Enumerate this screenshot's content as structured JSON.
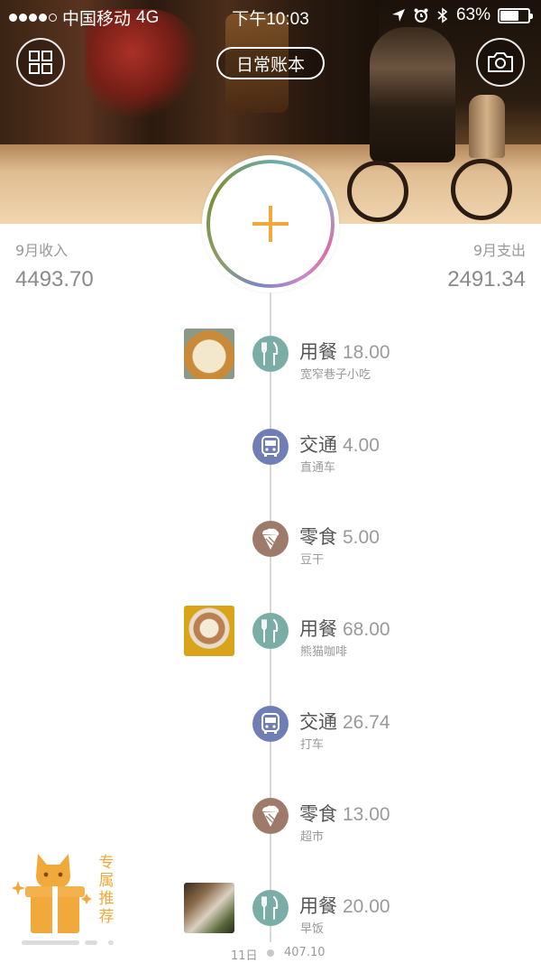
{
  "status_bar": {
    "carrier": "中国移动",
    "network": "4G",
    "time": "下午10:03",
    "battery": "63%",
    "battery_level": 0.63
  },
  "header": {
    "book_name": "日常账本",
    "grid_icon": "grid-icon",
    "camera_icon": "camera-icon"
  },
  "summary": {
    "income_label": "9月收入",
    "income_value": "4493.70",
    "expense_label": "9月支出",
    "expense_value": "2491.34"
  },
  "colors": {
    "meal": "#7aada6",
    "transport": "#6f7fb6",
    "snack": "#9e7a6a",
    "accent": "#f0a93a"
  },
  "entries": [
    {
      "category": "用餐",
      "amount": "18.00",
      "note": "宽窄巷子小吃",
      "icon": "fork-knife-icon",
      "has_photo": true
    },
    {
      "category": "交通",
      "amount": "4.00",
      "note": "直通车",
      "icon": "bus-icon",
      "has_photo": false
    },
    {
      "category": "零食",
      "amount": "5.00",
      "note": "豆干",
      "icon": "ice-cream-icon",
      "has_photo": false
    },
    {
      "category": "用餐",
      "amount": "68.00",
      "note": "熊猫咖啡",
      "icon": "fork-knife-icon",
      "has_photo": true
    },
    {
      "category": "交通",
      "amount": "26.74",
      "note": "打车",
      "icon": "bus-icon",
      "has_photo": false
    },
    {
      "category": "零食",
      "amount": "13.00",
      "note": "超市",
      "icon": "ice-cream-icon",
      "has_photo": false
    },
    {
      "category": "用餐",
      "amount": "20.00",
      "note": "早饭",
      "icon": "fork-knife-icon",
      "has_photo": true
    }
  ],
  "footer": {
    "date": "11日",
    "day_total": "407.10"
  },
  "promo": {
    "text": "专属推荐"
  }
}
